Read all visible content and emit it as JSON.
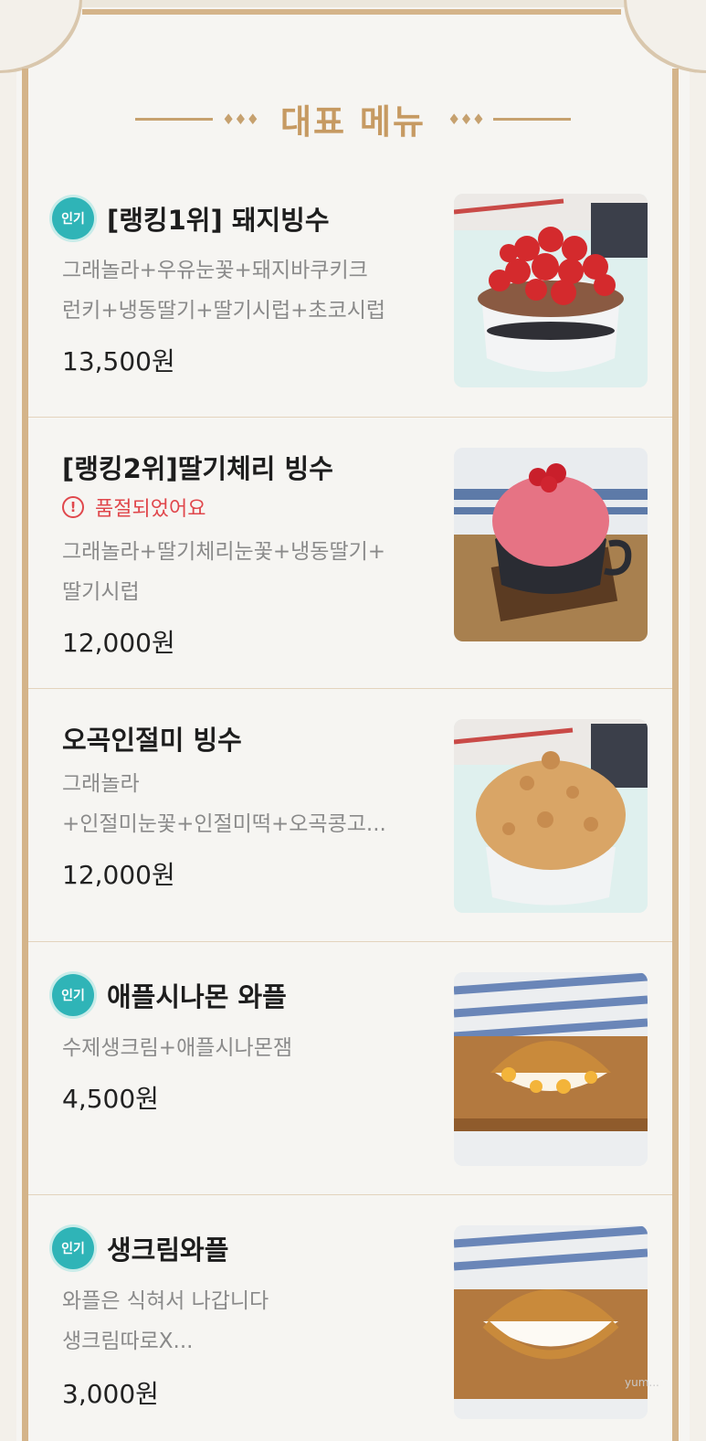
{
  "section": {
    "title": "대표 메뉴",
    "dots": "♦♦♦"
  },
  "items": [
    {
      "badge": "인기",
      "name": "[랭킹1위] 돼지빙수",
      "desc_lines": [
        "그래놀라+우유눈꽃+돼지바쿠키크",
        "런키+냉동딸기+딸기시럽+초코시럽"
      ],
      "price": "13,500원",
      "image": "strawberry-bingsu-photo"
    },
    {
      "badge": "",
      "name": "[랭킹2위]딸기체리 빙수",
      "soldout": "품절되었어요",
      "desc_lines": [
        "그래놀라+딸기체리눈꽃+냉동딸기+",
        "딸기시럽"
      ],
      "price": "12,000원",
      "image": "strawberry-cherry-bingsu-photo"
    },
    {
      "badge": "",
      "name": "오곡인절미 빙수",
      "desc_lines": [
        "그래놀라",
        "+인절미눈꽃+인절미떡+오곡콩고..."
      ],
      "price": "12,000원",
      "image": "injeolmi-bingsu-photo"
    },
    {
      "badge": "인기",
      "name": "애플시나몬 와플",
      "desc_lines": [
        "수제생크림+애플시나몬잼"
      ],
      "price": "4,500원",
      "image": "apple-cinnamon-waffle-photo"
    },
    {
      "badge": "인기",
      "name": "생크림와플",
      "desc_lines": [
        "와플은 식혀서 나갑니다",
        "생크림따로X..."
      ],
      "price": "3,000원",
      "image": "cream-waffle-photo"
    }
  ],
  "soldout_icon": "!",
  "watermark": "yum..."
}
